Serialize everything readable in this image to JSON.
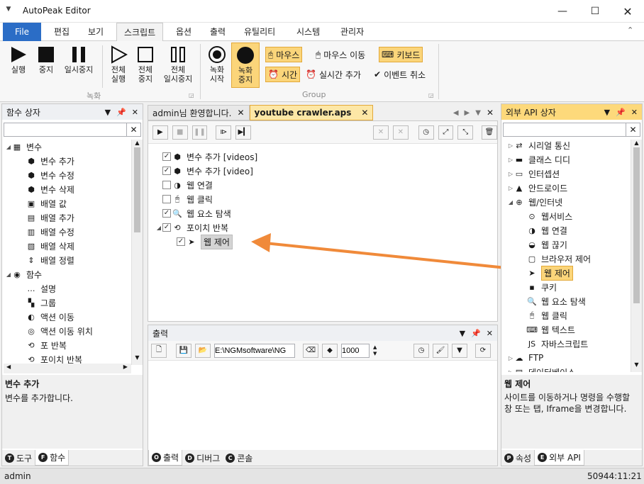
{
  "window": {
    "title": "AutoPeak Editor"
  },
  "menu": {
    "file": "File",
    "items": [
      "편집",
      "보기",
      "스크립트",
      "옵션",
      "출력",
      "유틸리티",
      "시스템",
      "관리자"
    ]
  },
  "ribbon": {
    "record_group": {
      "label": "녹화",
      "run": "실행",
      "stop": "중지",
      "pause": "일시중지",
      "run_all": [
        "전체",
        "실행"
      ],
      "stop_all": [
        "전체",
        "중지"
      ],
      "pause_all": [
        "전체",
        "일시중지"
      ]
    },
    "group_group": {
      "label": "Group",
      "rec_start": [
        "녹화",
        "시작"
      ],
      "rec_stop": [
        "녹화",
        "중지"
      ],
      "mouse": "마우스",
      "mouse_move": "마우스 이동",
      "keyboard": "키보드",
      "time": "시간",
      "realtime_add": "실시간 추가",
      "event_cancel": "이벤트 취소"
    }
  },
  "left_panel": {
    "title": "함수 상자",
    "search_value": "",
    "tree": [
      {
        "label": "변수",
        "level": 0,
        "expanded": true,
        "icon": "variable-icon"
      },
      {
        "label": "변수 추가",
        "level": 1,
        "icon": "cube-icon"
      },
      {
        "label": "변수 수정",
        "level": 1,
        "icon": "cube-icon"
      },
      {
        "label": "변수 삭제",
        "level": 1,
        "icon": "cube-icon"
      },
      {
        "label": "배열 값",
        "level": 1,
        "icon": "array-icon"
      },
      {
        "label": "배열 추가",
        "level": 1,
        "icon": "array-add-icon"
      },
      {
        "label": "배열 수정",
        "level": 1,
        "icon": "array-edit-icon"
      },
      {
        "label": "배열 삭제",
        "level": 1,
        "icon": "array-delete-icon"
      },
      {
        "label": "배열 정렬",
        "level": 1,
        "icon": "sort-icon"
      },
      {
        "label": "함수",
        "level": 0,
        "expanded": true,
        "icon": "function-icon"
      },
      {
        "label": "설명",
        "level": 1,
        "icon": "comment-icon"
      },
      {
        "label": "그룹",
        "level": 1,
        "icon": "group-icon"
      },
      {
        "label": "액션 이동",
        "level": 1,
        "icon": "goto-icon"
      },
      {
        "label": "액션 이동 위치",
        "level": 1,
        "icon": "target-icon"
      },
      {
        "label": "포 반복",
        "level": 1,
        "icon": "loop-icon"
      },
      {
        "label": "포이치 반복",
        "level": 1,
        "icon": "loop-icon"
      }
    ],
    "desc_title": "변수 추가",
    "desc_text": "변수를 추가합니다.",
    "bottom_tabs": [
      {
        "badge": "T",
        "label": "도구"
      },
      {
        "badge": "F",
        "label": "함수"
      }
    ]
  },
  "editor": {
    "tabs": [
      {
        "label": "admin님 환영합니다.",
        "active": false
      },
      {
        "label": "youtube crawler.aps",
        "active": true
      }
    ],
    "tree": [
      {
        "label": "변수 추가 [videos]",
        "checked": true,
        "level": 0,
        "icon": "cube-icon"
      },
      {
        "label": "변수 추가 [video]",
        "checked": true,
        "level": 0,
        "icon": "cube-icon"
      },
      {
        "label": "웹 연결",
        "checked": false,
        "level": 0,
        "icon": "web-connect-icon"
      },
      {
        "label": "웹 클릭",
        "checked": false,
        "level": 0,
        "icon": "mouse-click-icon"
      },
      {
        "label": "웹 요소 탐색",
        "checked": true,
        "level": 0,
        "icon": "search-icon"
      },
      {
        "label": "포이치 반복",
        "checked": true,
        "level": 0,
        "icon": "loop-icon",
        "expanded": true
      },
      {
        "label": "웹 제어",
        "checked": true,
        "level": 1,
        "icon": "navigation-icon",
        "selected": true
      }
    ]
  },
  "output": {
    "title": "출력",
    "path_value": "E:\\NGMsoftware\\NG",
    "delay_value": "1000",
    "bottom_tabs": [
      {
        "badge": "O",
        "label": "출력"
      },
      {
        "badge": "D",
        "label": "디버그"
      },
      {
        "badge": "C",
        "label": "콘솔"
      }
    ]
  },
  "right_panel": {
    "title": "외부 API 상자",
    "search_value": "",
    "tree": [
      {
        "label": "시리얼 통신",
        "level": 0,
        "icon": "serial-icon"
      },
      {
        "label": "클래스 디디",
        "level": 0,
        "icon": "class-icon"
      },
      {
        "label": "인터셉션",
        "level": 0,
        "icon": "monitor-icon"
      },
      {
        "label": "안드로이드",
        "level": 0,
        "icon": "android-icon"
      },
      {
        "label": "웹/인터넷",
        "level": 0,
        "icon": "globe-icon",
        "expanded": true
      },
      {
        "label": "웹서비스",
        "level": 1,
        "icon": "webservice-icon"
      },
      {
        "label": "웹 연결",
        "level": 1,
        "icon": "web-connect-icon"
      },
      {
        "label": "웹 끊기",
        "level": 1,
        "icon": "web-disconnect-icon"
      },
      {
        "label": "브라우저 제어",
        "level": 1,
        "icon": "browser-icon"
      },
      {
        "label": "웹 제어",
        "level": 1,
        "icon": "navigation-icon",
        "selected": true
      },
      {
        "label": "쿠키",
        "level": 1,
        "icon": "cookie-icon"
      },
      {
        "label": "웹 요소 탐색",
        "level": 1,
        "icon": "search-icon"
      },
      {
        "label": "웹 클릭",
        "level": 1,
        "icon": "mouse-click-icon"
      },
      {
        "label": "웹 텍스트",
        "level": 1,
        "icon": "keyboard-icon"
      },
      {
        "label": "자바스크립트",
        "level": 1,
        "icon": "javascript-icon"
      },
      {
        "label": "FTP",
        "level": 0,
        "icon": "ftp-icon"
      },
      {
        "label": "데이터베이스",
        "level": 0,
        "icon": "database-icon"
      }
    ],
    "desc_title": "웹 제어",
    "desc_text": "사이트를 이동하거나 명령을 수행할 창 또는 탭, Iframe을 변경합니다.",
    "bottom_tabs": [
      {
        "badge": "P",
        "label": "속성"
      },
      {
        "badge": "E",
        "label": "외부 API"
      }
    ]
  },
  "status": {
    "user": "admin",
    "time": "50944:11:21"
  },
  "colors": {
    "accent": "#2b6dc6",
    "highlight": "#fbd57a",
    "arrow": "#f08a3a"
  }
}
